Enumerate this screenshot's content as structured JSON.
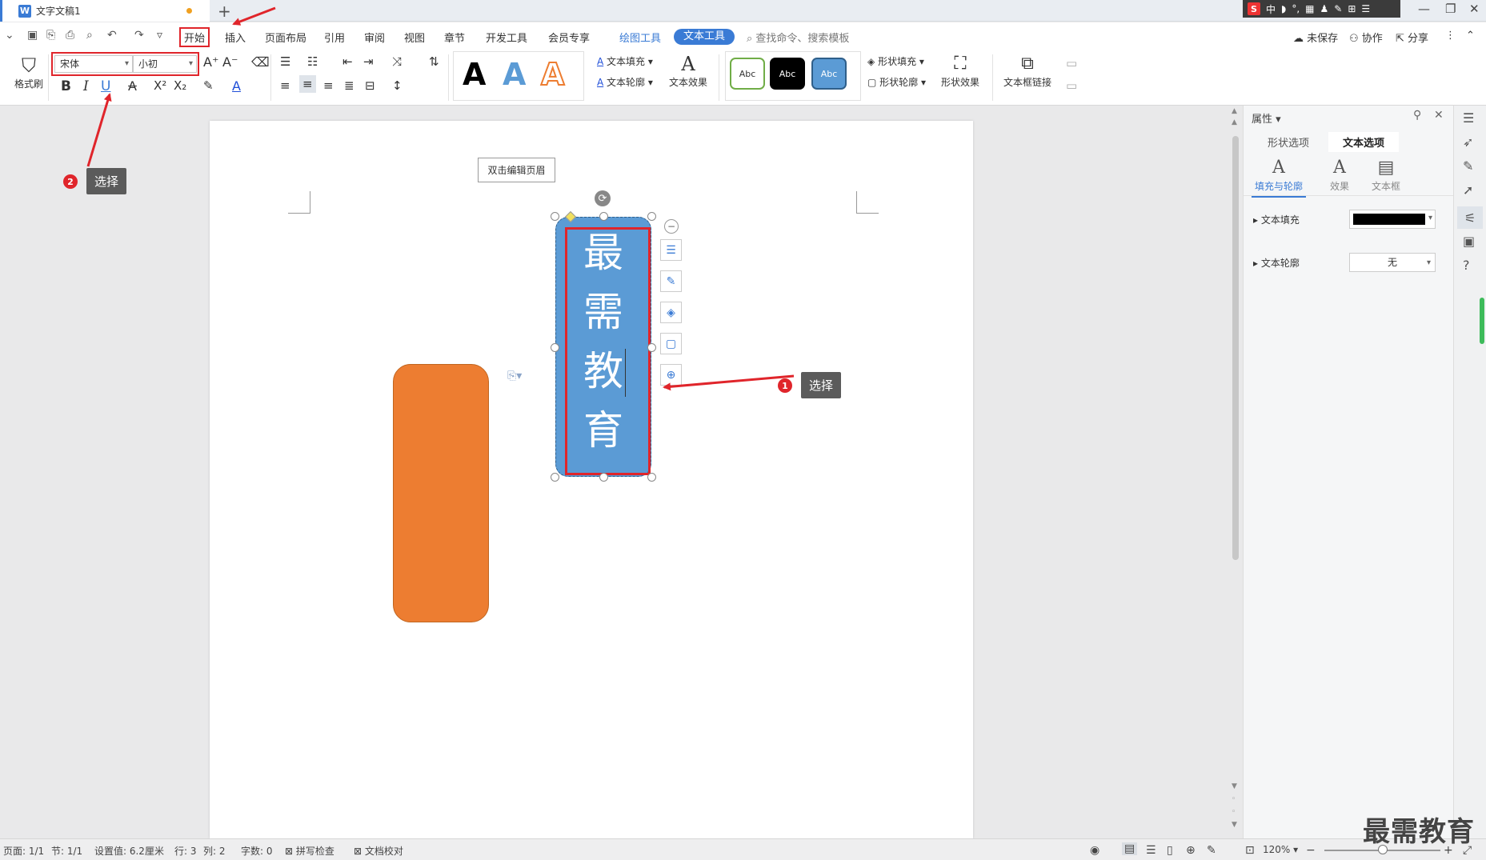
{
  "titlebar": {
    "doc_title": "文字文稿1",
    "doc_icon": "W",
    "new_tab": "+",
    "ime": {
      "logo": "S",
      "items": [
        "中",
        "◗",
        "°,",
        "▦",
        "♟",
        "✎",
        "⊞",
        "☰"
      ]
    }
  },
  "menu": {
    "items": [
      "开始",
      "插入",
      "页面布局",
      "引用",
      "审阅",
      "视图",
      "章节",
      "开发工具",
      "会员专享"
    ],
    "drawing_tools": "绘图工具",
    "text_tools": "文本工具",
    "search": "查找命令、搜索模板",
    "unsaved": "未保存",
    "collab": "协作",
    "share": "分享"
  },
  "ribbon": {
    "format_painter": "格式刷",
    "font_name": "宋体",
    "font_size": "小初",
    "text_fill": "文本填充",
    "text_outline": "文本轮廓",
    "text_effect": "文本效果",
    "style_sample": "Abc",
    "shape_fill": "形状填充",
    "shape_outline": "形状轮廓",
    "shape_effect": "形状效果",
    "textbox_link": "文本框链接"
  },
  "document": {
    "header_hint": "双击编辑页眉",
    "vertical_text": [
      "最",
      "需",
      "教",
      "育"
    ]
  },
  "callouts": {
    "one": {
      "num": "1",
      "text": "选择"
    },
    "two": {
      "num": "2",
      "text": "选择"
    }
  },
  "panel": {
    "title": "属性",
    "tab_shape": "形状选项",
    "tab_text": "文本选项",
    "sub_fill": "填充与轮廓",
    "sub_effect": "效果",
    "sub_textbox": "文本框",
    "text_fill_label": "文本填充",
    "text_fill_color": "#000000",
    "text_outline_label": "文本轮廓",
    "text_outline_value": "无"
  },
  "status": {
    "page": "页面: 1/1",
    "section": "节: 1/1",
    "setting": "设置值: 6.2厘米",
    "row": "行: 3",
    "col": "列: 2",
    "words": "字数: 0",
    "spell": "拼写检查",
    "proof": "文档校对",
    "zoom": "120%"
  },
  "watermark": "最需教育"
}
